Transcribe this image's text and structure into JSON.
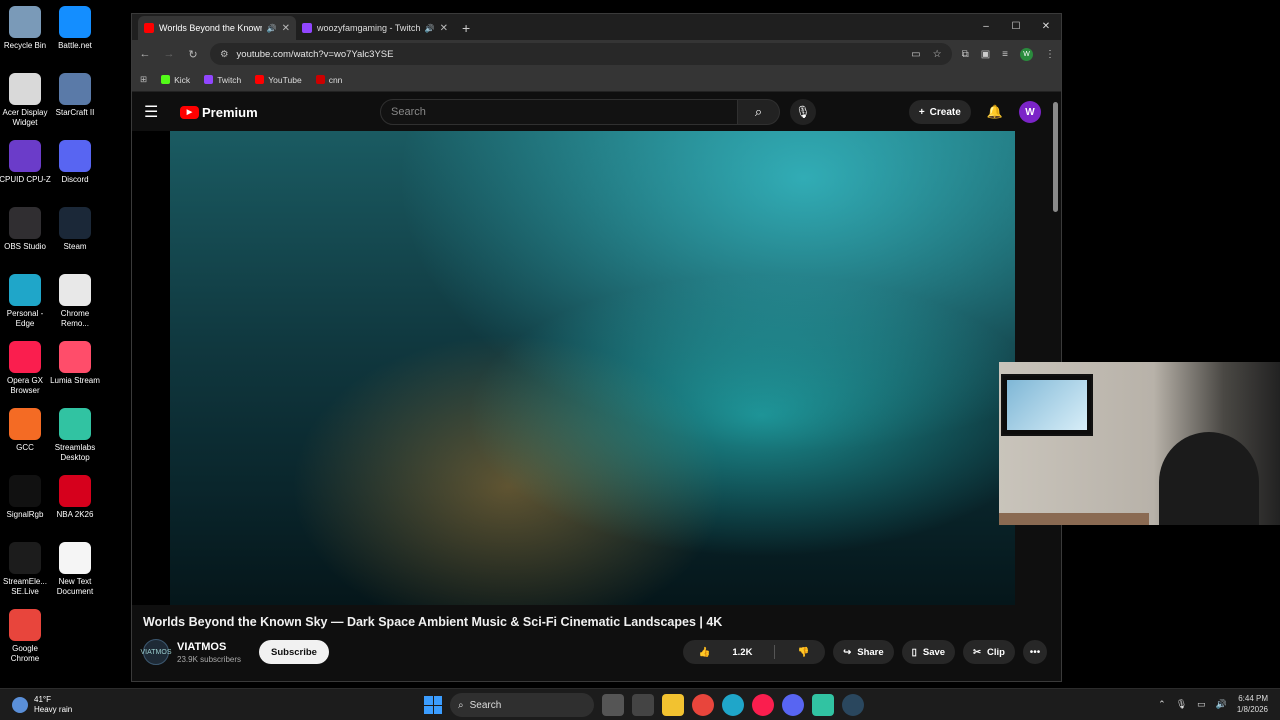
{
  "desktop": {
    "icons": [
      {
        "label": "Recycle Bin",
        "icon": "recycle-bin-icon",
        "color": "#7a9ab8"
      },
      {
        "label": "Battle.net",
        "icon": "battlenet-icon",
        "color": "#148eff"
      },
      {
        "label": "Acer Display Widget",
        "icon": "acer-icon",
        "color": "#d9d9d9"
      },
      {
        "label": "StarCraft II",
        "icon": "starcraft-icon",
        "color": "#5a7aa8"
      },
      {
        "label": "CPUID CPU-Z",
        "icon": "cpuz-icon",
        "color": "#6b3cc9"
      },
      {
        "label": "Discord",
        "icon": "discord-icon",
        "color": "#5865f2"
      },
      {
        "label": "OBS Studio",
        "icon": "obs-icon",
        "color": "#302e31"
      },
      {
        "label": "Steam",
        "icon": "steam-icon",
        "color": "#1b2838"
      },
      {
        "label": "Personal - Edge",
        "icon": "edge-icon",
        "color": "#1fa6c9"
      },
      {
        "label": "Chrome Remo...",
        "icon": "chrome-remote-icon",
        "color": "#e8e8e8"
      },
      {
        "label": "Opera GX Browser",
        "icon": "opera-gx-icon",
        "color": "#fa1e4e"
      },
      {
        "label": "Lumia Stream",
        "icon": "lumia-icon",
        "color": "#ff4d6a"
      },
      {
        "label": "GCC",
        "icon": "gcc-icon",
        "color": "#f46b24"
      },
      {
        "label": "Streamlabs Desktop",
        "icon": "streamlabs-icon",
        "color": "#31c3a2"
      },
      {
        "label": "SignalRgb",
        "icon": "signalrgb-icon",
        "color": "#111111"
      },
      {
        "label": "NBA 2K26",
        "icon": "nba2k-icon",
        "color": "#d6001c"
      },
      {
        "label": "StreamEle... SE.Live",
        "icon": "streamelements-icon",
        "color": "#1c1c1c"
      },
      {
        "label": "New Text Document",
        "icon": "text-document-icon",
        "color": "#f5f5f5"
      },
      {
        "label": "Google Chrome",
        "icon": "chrome-icon",
        "color": "#e8453c"
      }
    ]
  },
  "browser": {
    "tabs": [
      {
        "title": "Worlds Beyond the Known",
        "active": true,
        "fav_color": "#ff0000"
      },
      {
        "title": "woozyfamgaming - Twitch",
        "active": false,
        "fav_color": "#9146ff"
      }
    ],
    "new_tab": "+",
    "window_controls": {
      "min": "–",
      "max": "☐",
      "close": "✕"
    },
    "url": "youtube.com/watch?v=wo7Yalc3YSE",
    "profile_initial": "W",
    "bookmarks": [
      {
        "label": "Kick",
        "color": "#53fc18"
      },
      {
        "label": "Twitch",
        "color": "#9146ff"
      },
      {
        "label": "YouTube",
        "color": "#ff0000"
      },
      {
        "label": "cnn",
        "color": "#cc0000"
      }
    ]
  },
  "youtube": {
    "logo_text": "Premium",
    "search_placeholder": "Search",
    "create_label": "Create",
    "avatar_initial": "W",
    "video_title": "Worlds Beyond the Known Sky — Dark Space Ambient Music & Sci-Fi Cinematic Landscapes | 4K",
    "channel": {
      "name": "VIATMOS",
      "subscribers": "23.9K subscribers",
      "avatar_text": "VIATMOS"
    },
    "subscribe_label": "Subscribe",
    "likes": "1.2K",
    "share_label": "Share",
    "save_label": "Save",
    "clip_label": "Clip"
  },
  "taskbar": {
    "weather_temp": "41°F",
    "weather_desc": "Heavy rain",
    "search_label": "Search",
    "time": "6:44 PM",
    "date": "1/8/2026"
  }
}
